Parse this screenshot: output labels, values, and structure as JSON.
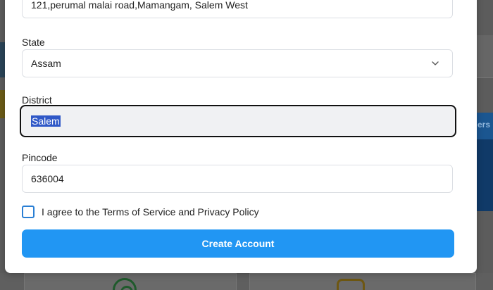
{
  "background": {
    "side_text": "ers"
  },
  "form": {
    "address_value": "121,perumal malai road,Mamangam, Salem West",
    "state": {
      "label": "State",
      "selected": "Assam"
    },
    "district": {
      "label": "District",
      "value": "Salem"
    },
    "pincode": {
      "label": "Pincode",
      "value": "636004"
    },
    "agree_text": "I agree to the Terms of Service and Privacy Policy",
    "submit_label": "Create Account"
  },
  "colors": {
    "primary": "#2196f3",
    "selection": "#2f58c7",
    "checkbox_border": "#2a7fd4"
  }
}
